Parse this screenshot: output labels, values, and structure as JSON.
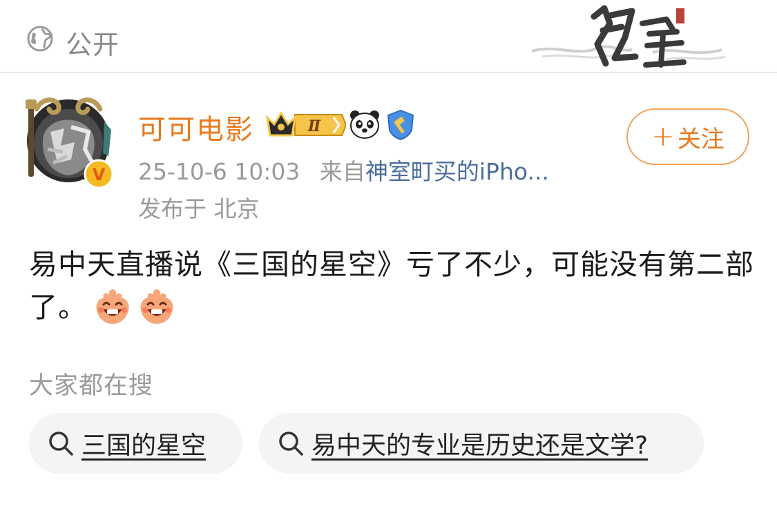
{
  "header": {
    "visibility_icon": "globe-icon",
    "visibility_label": "公开",
    "decoration": "calligraphy-banner"
  },
  "post": {
    "author": {
      "name": "可可电影",
      "avatar": "avatar-image",
      "verified_mark": "V",
      "badges": [
        {
          "icon": "crown-level-icon",
          "text": "Ⅱ"
        },
        {
          "icon": "panda-icon"
        },
        {
          "icon": "shield-gavel-icon"
        }
      ]
    },
    "timestamp": "25-10-6 10:03",
    "source_prefix": "来自",
    "source": "神室町买的iPho...",
    "location": "发布于 北京",
    "follow_label": "关注",
    "follow_icon": "plus-icon",
    "body_text": "易中天直播说《三国的星空》亏了不少，可能没有第二部了。",
    "emojis": [
      "laughing-face-icon",
      "laughing-face-icon"
    ]
  },
  "trending": {
    "title": "大家都在搜",
    "items": [
      {
        "label": "三国的星空",
        "icon": "search-icon"
      },
      {
        "label": "易中天的专业是历史还是文学?",
        "icon": "search-icon"
      }
    ]
  },
  "colors": {
    "accent": "#e8791d",
    "link": "#4a6d9c",
    "muted": "#9a9a9a",
    "chip_bg": "#f4f4f4"
  }
}
